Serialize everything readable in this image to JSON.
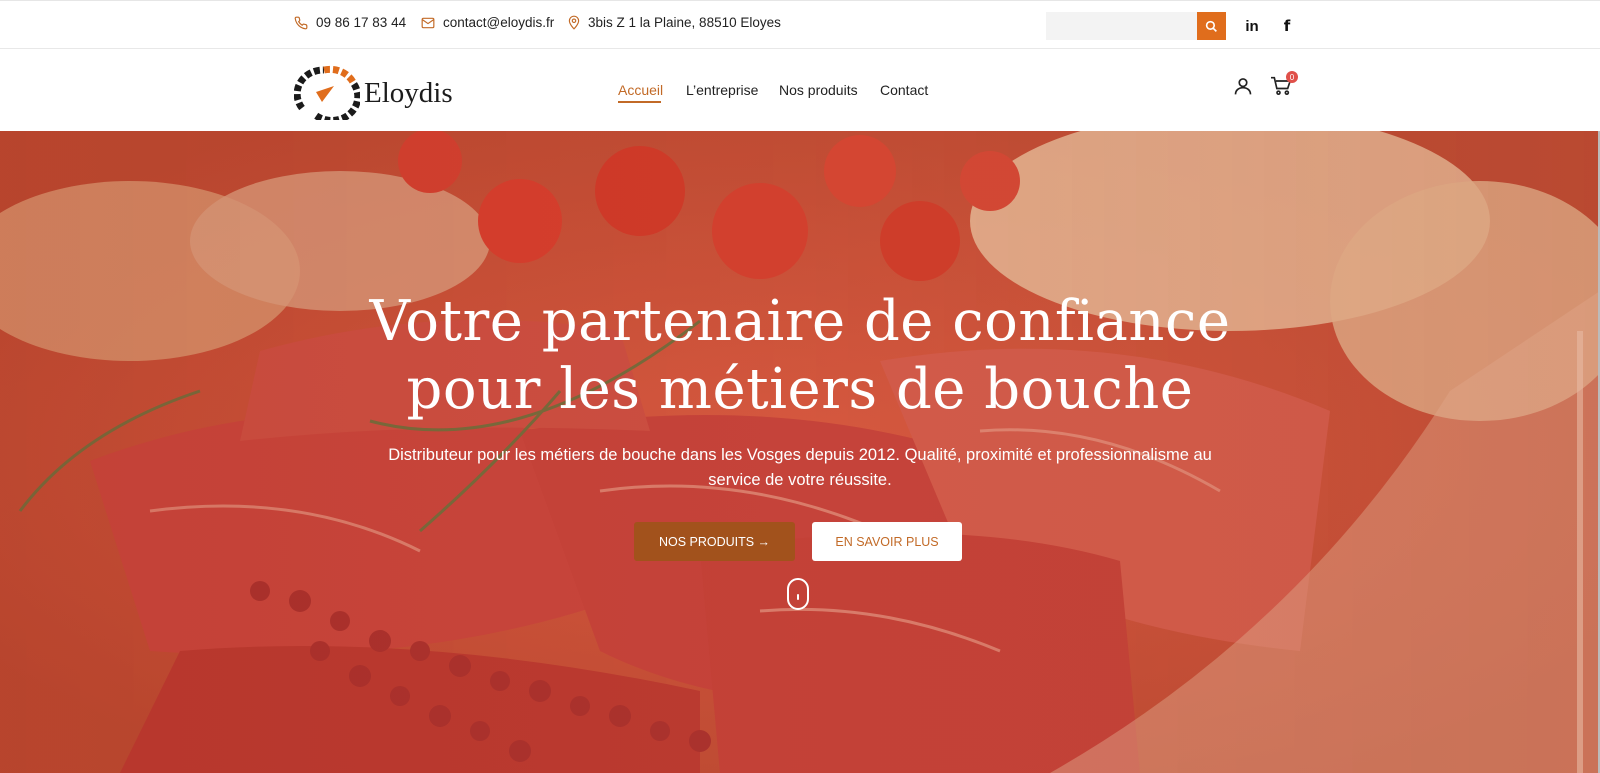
{
  "topbar": {
    "phone": "09 86 17 83 44",
    "email": "contact@eloydis.fr",
    "address": "3bis Z 1 la Plaine, 88510 Eloyes",
    "search": {
      "value": "",
      "placeholder": ""
    },
    "social": {
      "linkedin": "in",
      "facebook": "f"
    }
  },
  "header": {
    "logo_text": "Eloydis",
    "nav": [
      {
        "label": "Accueil",
        "active": true
      },
      {
        "label": "L’entreprise",
        "active": false
      },
      {
        "label": "Nos produits",
        "active": false
      },
      {
        "label": "Contact",
        "active": false
      }
    ],
    "cart_count": "0"
  },
  "hero": {
    "title_line1": "Votre partenaire de confiance",
    "title_line2": "pour les métiers de bouche",
    "subtitle": "Distributeur pour les métiers de bouche dans les Vosges depuis 2012. Qualité, proximité et professionnalisme au service de votre réussite.",
    "primary_button": "NOS PRODUITS →",
    "secondary_button": "EN SAVOIR PLUS"
  },
  "colors": {
    "accent": "#e06d1c",
    "brand_brown": "#a2521c",
    "nav_active": "#c26a27"
  },
  "icons": [
    "phone-icon",
    "mail-icon",
    "location-pin-icon",
    "search-icon",
    "linkedin-icon",
    "facebook-icon",
    "user-icon",
    "cart-icon",
    "scroll-down-icon"
  ]
}
